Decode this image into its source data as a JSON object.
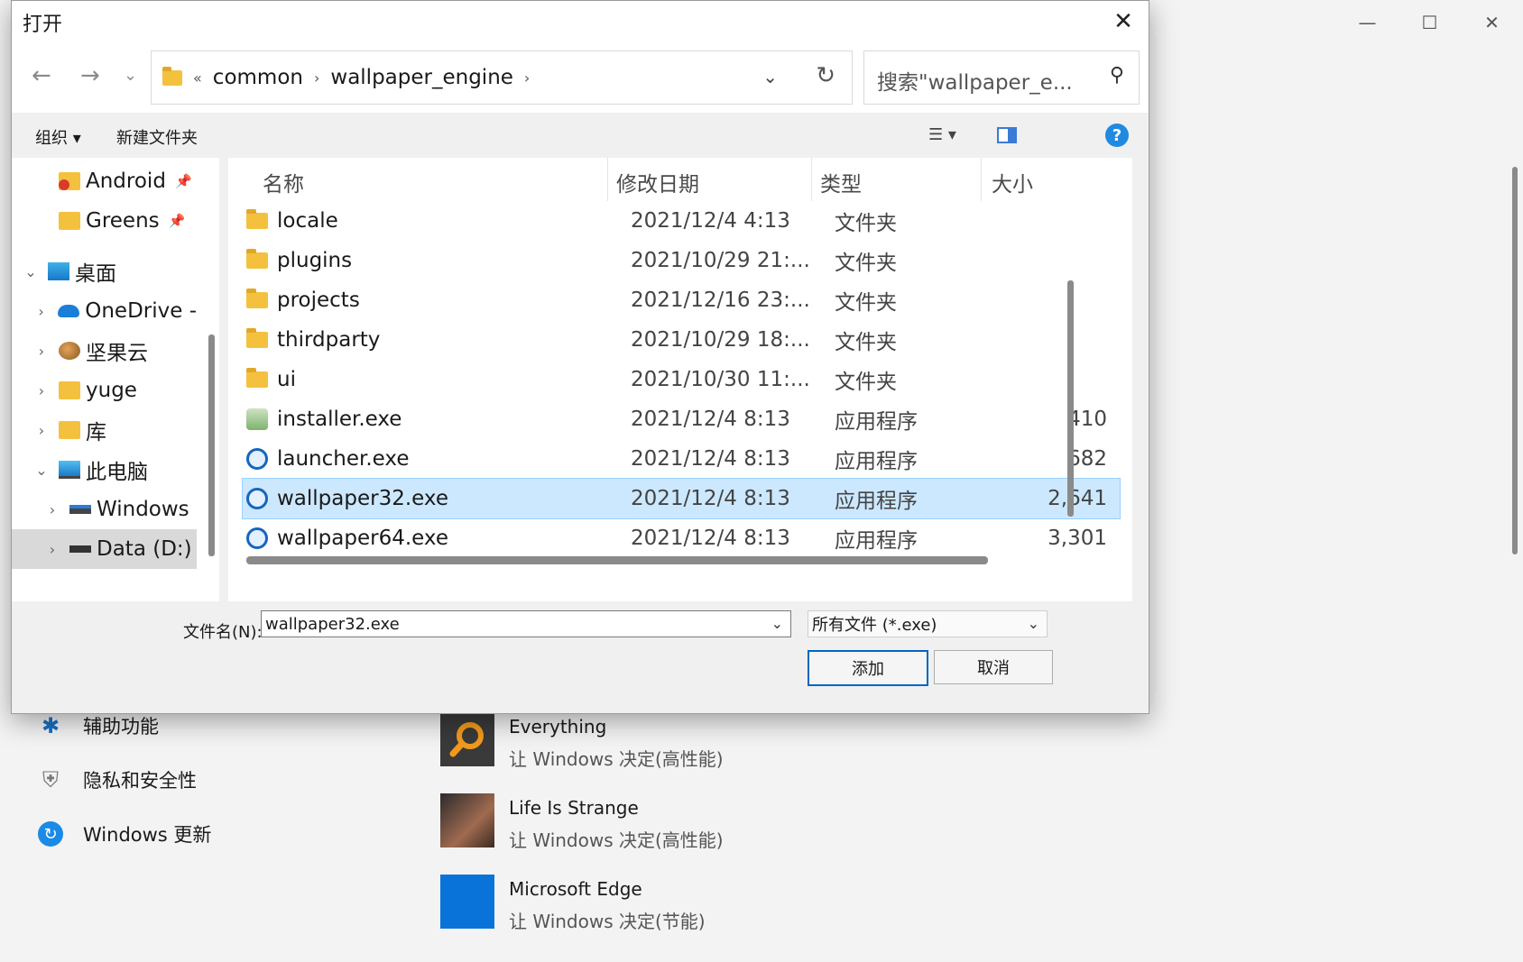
{
  "dialog": {
    "title": "打开",
    "close_glyph": "✕",
    "nav": {
      "back": "←",
      "forward": "→",
      "recent": "⌄"
    },
    "breadcrumb": {
      "overflow": "«",
      "items": [
        "common",
        "wallpaper_engine"
      ],
      "sep": "›"
    },
    "address_dropdown": "⌄",
    "refresh": "↻",
    "search_placeholder": "搜索\"wallpaper_e...",
    "toolbar": {
      "organize": "组织 ▾",
      "new_folder": "新建文件夹",
      "view": "☰ ▾",
      "pane": "▮",
      "help": "?"
    },
    "tree": [
      {
        "label": "Android",
        "pinned": true,
        "icon": "android-icon",
        "indent": 44,
        "chev": ""
      },
      {
        "label": "Greens",
        "pinned": true,
        "icon": "folder-icon",
        "indent": 44,
        "chev": ""
      },
      {
        "label": "桌面",
        "pinned": false,
        "icon": "desktop-icon",
        "indent": 10,
        "chev": "⌄"
      },
      {
        "label": "OneDrive -",
        "pinned": false,
        "icon": "onedrive-icon",
        "indent": 22,
        "chev": "›"
      },
      {
        "label": "坚果云",
        "pinned": false,
        "icon": "nutstore-icon",
        "indent": 22,
        "chev": "›"
      },
      {
        "label": "yuge",
        "pinned": false,
        "icon": "folder-icon",
        "indent": 22,
        "chev": "›"
      },
      {
        "label": "库",
        "pinned": false,
        "icon": "library-icon",
        "indent": 22,
        "chev": "›"
      },
      {
        "label": "此电脑",
        "pinned": false,
        "icon": "pc-icon",
        "indent": 22,
        "chev": "⌄"
      },
      {
        "label": "Windows",
        "pinned": false,
        "icon": "drive-icon",
        "indent": 34,
        "chev": "›"
      },
      {
        "label": "Data (D:)",
        "pinned": false,
        "icon": "drive-icon",
        "indent": 34,
        "chev": "›"
      }
    ],
    "columns": {
      "name": "名称",
      "date": "修改日期",
      "type": "类型",
      "size": "大小"
    },
    "files": [
      {
        "name": "locale",
        "date": "2021/12/4 4:13",
        "type": "文件夹",
        "size": "",
        "kind": "folder"
      },
      {
        "name": "plugins",
        "date": "2021/10/29 21:...",
        "type": "文件夹",
        "size": "",
        "kind": "folder"
      },
      {
        "name": "projects",
        "date": "2021/12/16 23:...",
        "type": "文件夹",
        "size": "",
        "kind": "folder"
      },
      {
        "name": "thirdparty",
        "date": "2021/10/29 18:...",
        "type": "文件夹",
        "size": "",
        "kind": "folder"
      },
      {
        "name": "ui",
        "date": "2021/10/30 11:...",
        "type": "文件夹",
        "size": "",
        "kind": "folder"
      },
      {
        "name": "installer.exe",
        "date": "2021/12/4 8:13",
        "type": "应用程序",
        "size": "410",
        "kind": "installer"
      },
      {
        "name": "launcher.exe",
        "date": "2021/12/4 8:13",
        "type": "应用程序",
        "size": "682",
        "kind": "exe"
      },
      {
        "name": "wallpaper32.exe",
        "date": "2021/12/4 8:13",
        "type": "应用程序",
        "size": "2,641",
        "kind": "exe",
        "selected": true
      },
      {
        "name": "wallpaper64.exe",
        "date": "2021/12/4 8:13",
        "type": "应用程序",
        "size": "3,301",
        "kind": "exe"
      }
    ],
    "filename_label": "文件名(N):",
    "filename_value": "wallpaper32.exe",
    "filter_value": "所有文件 (*.exe)",
    "dropdown_glyph": "⌄",
    "add_button": "添加",
    "cancel_button": "取消"
  },
  "background": {
    "caption": {
      "minimize": "—",
      "maximize": "☐",
      "close": "✕"
    },
    "nav_items": [
      {
        "label": "辅助功能",
        "icon": "accessibility-icon",
        "glyph": "✱"
      },
      {
        "label": "隐私和安全性",
        "icon": "shield-icon",
        "glyph": "⛨"
      },
      {
        "label": "Windows 更新",
        "icon": "update-icon",
        "glyph": "↻"
      }
    ],
    "apps": [
      {
        "name": "Everything",
        "sub": "让 Windows 决定(高性能)",
        "color": "#3a3a3a"
      },
      {
        "name": "Life Is Strange",
        "sub": "让 Windows 决定(高性能)",
        "color": "#6b4a3a"
      },
      {
        "name": "Microsoft Edge",
        "sub": "让 Windows 决定(节能)",
        "color": "#0a73d9"
      }
    ]
  }
}
